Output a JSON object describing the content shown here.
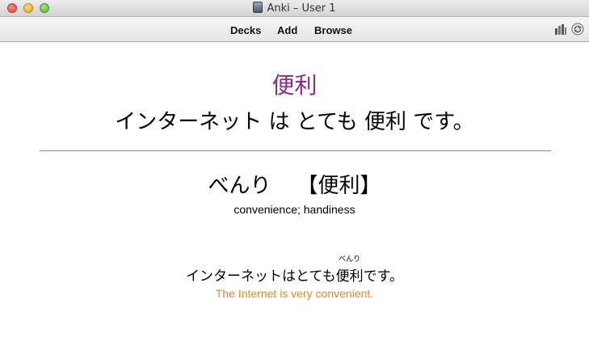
{
  "window": {
    "title": "Anki – User 1"
  },
  "toolbar": {
    "decks": "Decks",
    "add": "Add",
    "browse": "Browse"
  },
  "card": {
    "front_word": "便利",
    "front_sentence": "インターネット は とても 便利 です。",
    "reading": "べんり",
    "kanji_bracketed": "【便利】",
    "meaning": "convenience; handiness",
    "example_before": "インターネットはとても",
    "example_furigana": "べんり",
    "example_word": "便利",
    "example_after": "です。",
    "translation": "The Internet is very convenient."
  },
  "colors": {
    "front_word": "#8b2a8b",
    "translation": "#e08a1e"
  },
  "icons": [
    "close-button",
    "minimize-button",
    "zoom-button",
    "anki-app-icon",
    "stats-icon",
    "sync-icon"
  ]
}
